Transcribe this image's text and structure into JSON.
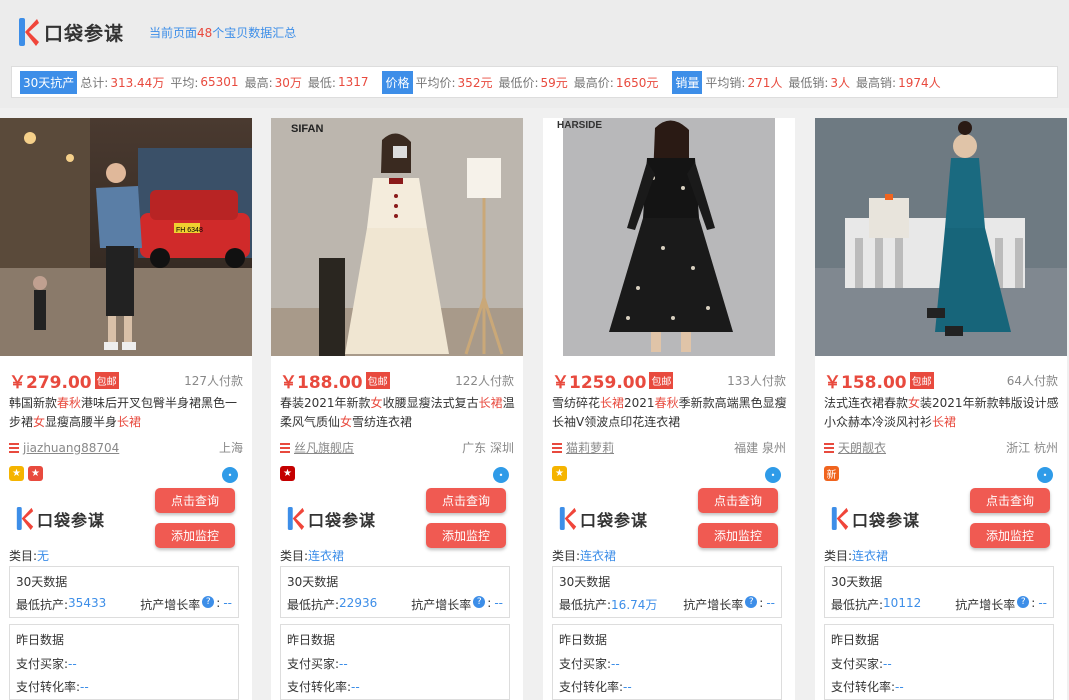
{
  "app": {
    "logo_text": "口袋参谋"
  },
  "page_summary": {
    "prefix": "当前页面",
    "count": "48",
    "suffix": "个宝贝数据汇总"
  },
  "stats": {
    "sales_tag": "30天抗产",
    "total_label": "总计:",
    "total": "313.44万",
    "avg_label": "平均:",
    "avg": "65301",
    "max_label": "最高:",
    "max": "30万",
    "min_label": "最低:",
    "min": "1317",
    "price_tag": "价格",
    "avg_price_label": "平均价:",
    "avg_price": "352元",
    "min_price_label": "最低价:",
    "min_price": "59元",
    "max_price_label": "最高价:",
    "max_price": "1650元",
    "volume_tag": "销量",
    "avg_sales_label": "平均销:",
    "avg_sales": "271人",
    "min_sales_label": "最低销:",
    "min_sales": "3人",
    "max_sales_label": "最高销:",
    "max_sales": "1974人"
  },
  "labels": {
    "baoyou": "包邮",
    "query_btn": "点击查询",
    "monitor_btn": "添加监控",
    "category": "类目:",
    "d30_title": "30天数据",
    "min_output": "最低抗产:",
    "growth": "抗产增长率",
    "growth_val": "--",
    "yesterday_title": "昨日数据",
    "buyers": "支付买家:",
    "conversion": "支付转化率:",
    "dash": "--"
  },
  "cards": [
    {
      "price": "￥279.00",
      "paid": "127人付款",
      "title": "韩国新款春秋港味后开叉包臀半身裙黑色一步裙女显瘦高腰半身长裙",
      "shop": "jiazhuang88704",
      "location": "上海",
      "category": "无",
      "min_output": "35433",
      "badges": [
        {
          "icon": "crown-icon",
          "color": "#f5b400"
        },
        {
          "icon": "heart-icon",
          "color": "#e84a3e"
        }
      ]
    },
    {
      "price": "￥188.00",
      "paid": "122人付款",
      "title": "春装2021年新款女收腰显瘦法式复古长裙温柔风气质仙女雪纺连衣裙",
      "shop": "丝凡旗舰店",
      "location": "广东 深圳",
      "category": "连衣裙",
      "min_output": "22936",
      "badges": [
        {
          "icon": "tmall-icon",
          "color": "#c40000"
        }
      ]
    },
    {
      "price": "￥1259.00",
      "paid": "133人付款",
      "title": "雪纺碎花长裙2021春秋季新款高端黑色显瘦长袖V领波点印花连衣裙",
      "shop": "猫莉萝莉",
      "location": "福建 泉州",
      "category": "连衣裙",
      "min_output": "16.74万",
      "badges": [
        {
          "icon": "crown-icon",
          "color": "#f5b400"
        }
      ]
    },
    {
      "price": "￥158.00",
      "paid": "64人付款",
      "title": "法式连衣裙春款女装2021年新款韩版设计感小众赫本冷淡风衬衫长裙",
      "shop": "天朗靓衣",
      "location": "浙江 杭州",
      "category": "连衣裙",
      "min_output": "10112",
      "badges": [
        {
          "icon": "new-icon",
          "color": "#f0641e",
          "text": "新"
        }
      ]
    }
  ],
  "photo_captions": [
    "",
    "SIFAN",
    "HARSIDE",
    ""
  ],
  "taxi_plate": "FH 6348",
  "colors": {
    "accent": "#3d8ee8",
    "red": "#e84a3e",
    "button": "#f05a52"
  }
}
